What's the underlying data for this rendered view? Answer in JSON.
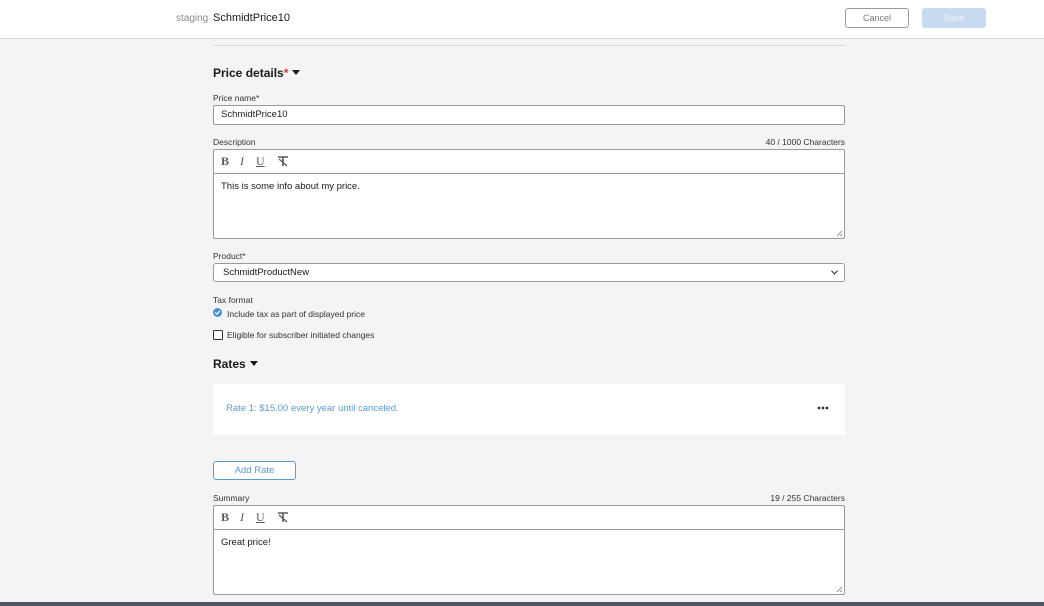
{
  "header": {
    "environment": "staging",
    "title": "SchmidtPrice10",
    "cancel_label": "Cancel",
    "save_label": "Save"
  },
  "price_details": {
    "title": "Price details",
    "required_mark": "*",
    "price_name": {
      "label": "Price name*",
      "value": "SchmidtPrice10"
    },
    "description": {
      "label": "Description",
      "counter": "40 / 1000 Characters",
      "toolbar": {
        "bold": "B",
        "italic": "I",
        "underline": "U"
      },
      "value": "This is some info about my price."
    },
    "product": {
      "label": "Product*",
      "selected": "SchmidtProductNew"
    },
    "tax_format": {
      "label": "Tax format",
      "option_label": "Include tax as part of displayed price",
      "checked": true
    },
    "subscriber_changes": {
      "label": "Eligible for subscriber initiated changes",
      "checked": false
    }
  },
  "rates": {
    "title": "Rates",
    "items": [
      {
        "text": "Rate 1: $15.00 every year until canceled."
      }
    ],
    "add_rate_label": "Add Rate"
  },
  "summary": {
    "label": "Summary",
    "counter": "19 / 255 Characters",
    "toolbar": {
      "bold": "B",
      "italic": "I",
      "underline": "U"
    },
    "value": "Great price!"
  },
  "colors": {
    "accent": "#5a9bd5",
    "checkbox": "#4a90d9",
    "required": "#d9363e",
    "save_disabled": "#c7dcf1"
  },
  "icons": [
    "caret-down-icon",
    "clear-format-icon",
    "chevron-down-icon",
    "checkmark-icon",
    "more-options-icon",
    "resize-grip-icon"
  ]
}
